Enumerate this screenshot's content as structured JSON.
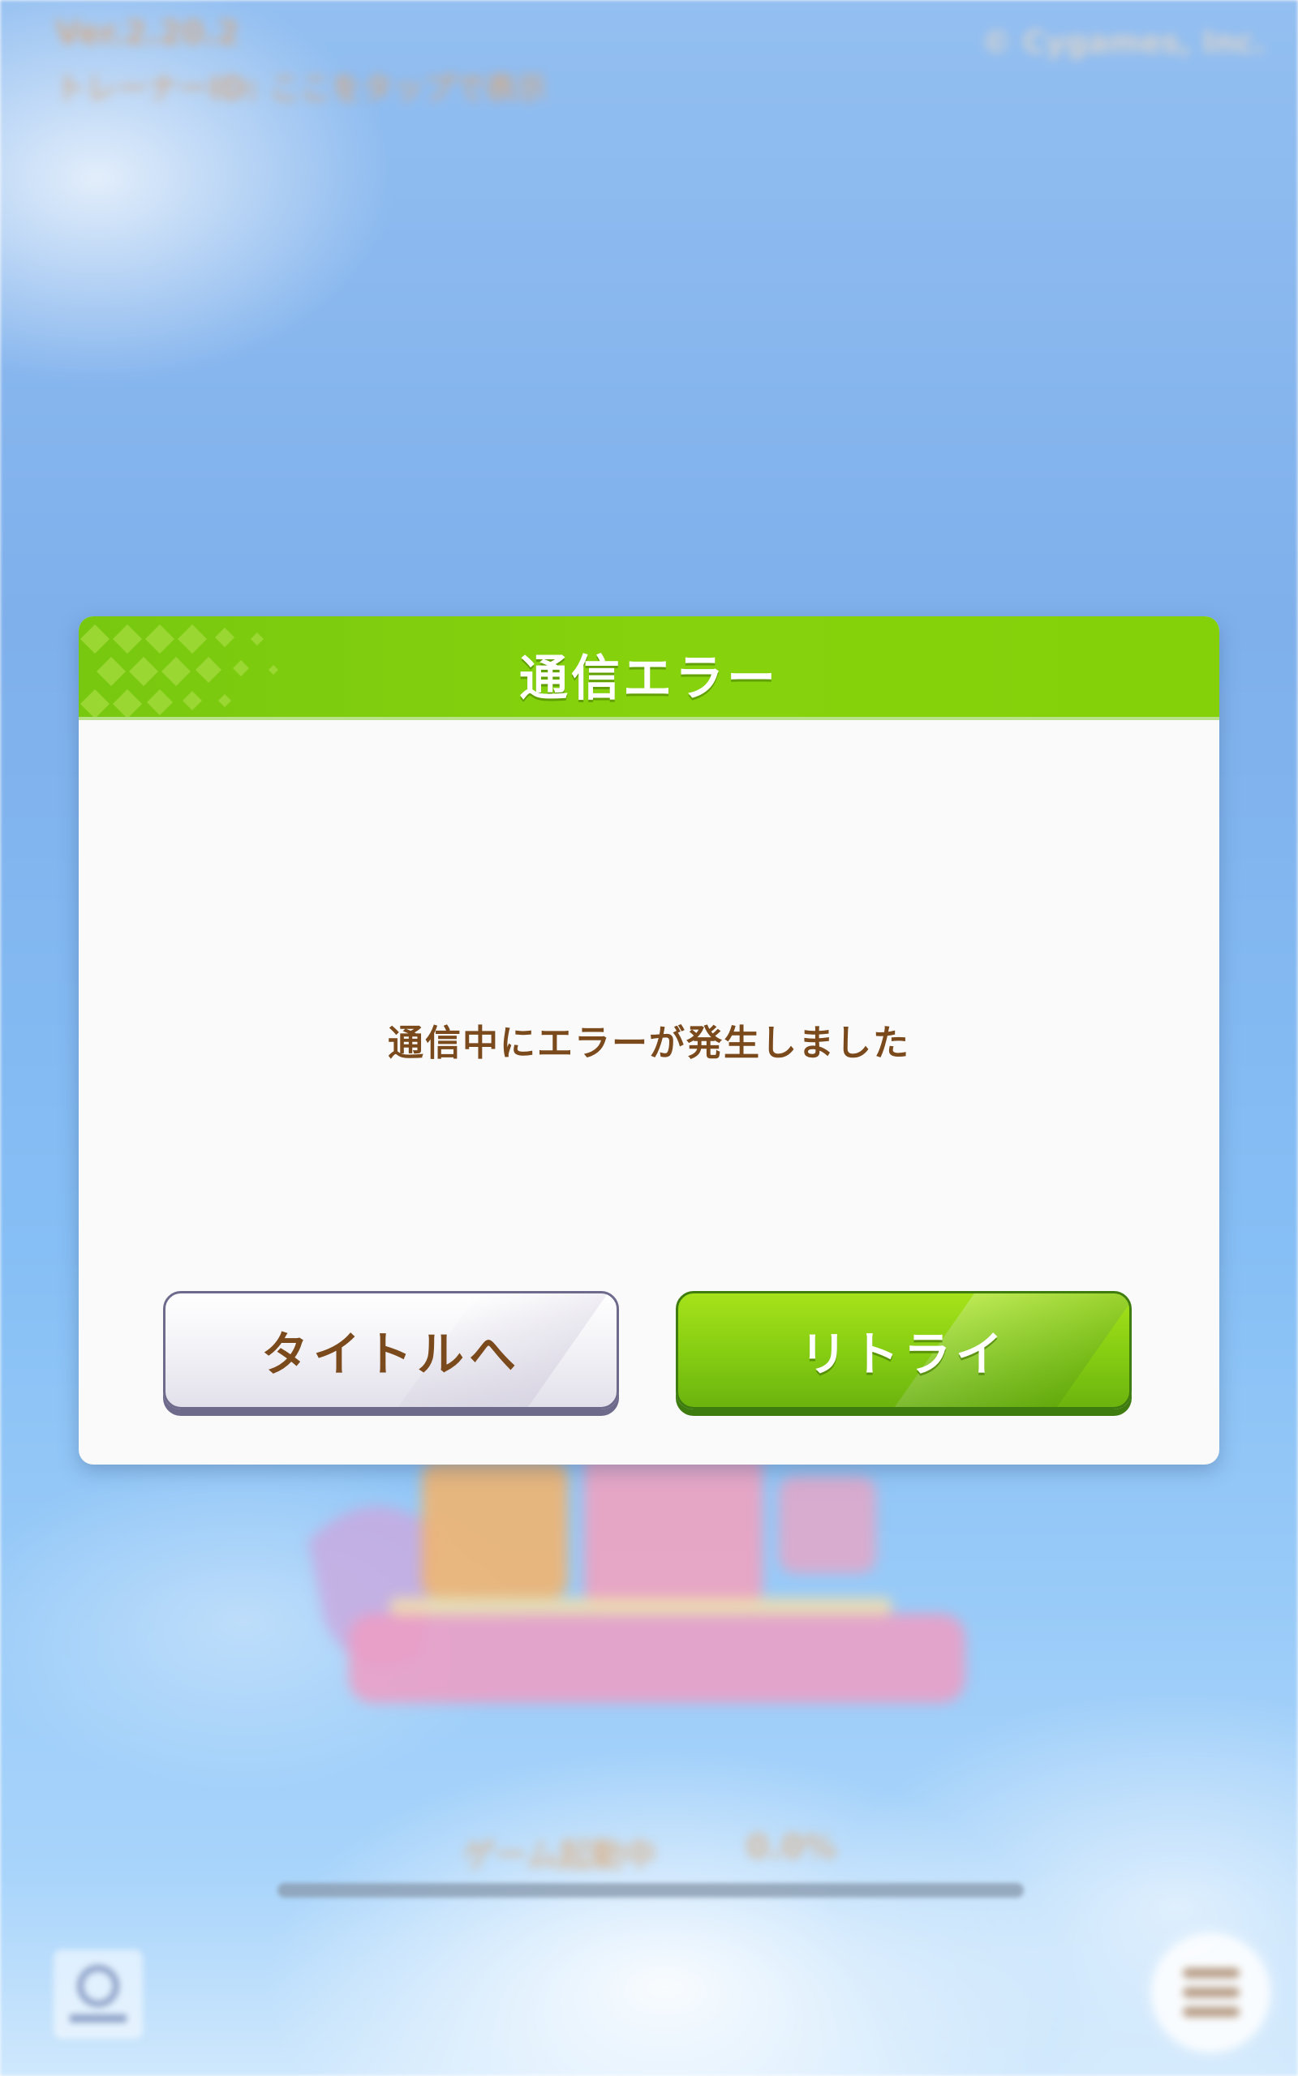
{
  "background": {
    "version": "Ver.2.20.2",
    "trainer_id": "トレーナーID: ここをタップで表示",
    "copyright": "© Cygames, Inc.",
    "loading": {
      "label": "ゲーム起動中",
      "percent_text": "0.0%",
      "progress": 0.0
    }
  },
  "dialog": {
    "title": "通信エラー",
    "message": "通信中にエラーが発生しました",
    "buttons": {
      "to_title": "タイトルへ",
      "retry": "リトライ"
    }
  },
  "colors": {
    "header_green": "#84d10a",
    "retry_green": "#84cc12",
    "text_brown": "#7a4a1c"
  },
  "icons": {
    "menu": "hamburger-menu-icon",
    "reset": "reset-icon"
  }
}
